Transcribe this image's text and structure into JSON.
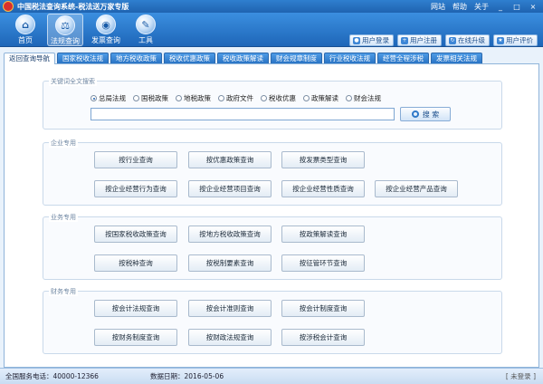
{
  "titlebar": {
    "title": "中国税法查询系统-税法送万家专版",
    "links": [
      "网站",
      "帮助",
      "关于"
    ],
    "window_buttons": [
      "_",
      "□",
      "×"
    ]
  },
  "toolbar": {
    "tools": [
      {
        "label": "首页",
        "icon": "home-icon",
        "glyph": "⌂"
      },
      {
        "label": "法规查询",
        "icon": "law-search-icon",
        "glyph": "⚖"
      },
      {
        "label": "发票查询",
        "icon": "invoice-search-icon",
        "glyph": "◉"
      },
      {
        "label": "工具",
        "icon": "tools-icon",
        "glyph": "✎"
      }
    ],
    "quick": [
      {
        "label": "用户登录",
        "icon": "user-login-icon"
      },
      {
        "label": "用户注册",
        "icon": "user-register-icon"
      },
      {
        "label": "在线升级",
        "icon": "upgrade-icon"
      },
      {
        "label": "用户评价",
        "icon": "feedback-icon"
      }
    ]
  },
  "tabs": [
    "返回查询导航",
    "国家税收法规",
    "地方税收政策",
    "税收优惠政策",
    "税收政策解读",
    "财会规章制度",
    "行业税收法规",
    "经营全程涉税",
    "发票相关法规"
  ],
  "search": {
    "legend": "关键词全文搜索",
    "options": [
      "总局法规",
      "国税政策",
      "地税政策",
      "政府文件",
      "税收优惠",
      "政策解读",
      "财会法规"
    ],
    "selected": "总局法规",
    "value": "",
    "button": "搜 索"
  },
  "groups": {
    "enterprise": {
      "title": "企业专用",
      "buttons": [
        "按行业查询",
        "按优惠政策查询",
        "按发票类型查询",
        "按企业经营行为查询",
        "按企业经营项目查询",
        "按企业经营性质查询",
        "按企业经营产品查询"
      ]
    },
    "business": {
      "title": "业务专用",
      "buttons": [
        "按国家税收政策查询",
        "按地方税收政策查询",
        "按政策解读查询",
        "按税种查询",
        "按税制要素查询",
        "按征管环节查询"
      ]
    },
    "finance": {
      "title": "财务专用",
      "buttons": [
        "按会计法规查询",
        "按会计准则查询",
        "按会计制度查询",
        "按财务制度查询",
        "按财政法规查询",
        "按涉税会计查询"
      ]
    }
  },
  "status": {
    "hotline": "全国服务电话：40000-12366",
    "date": "数据日期：2016-05-06",
    "login": "[ 未登录 ]"
  }
}
